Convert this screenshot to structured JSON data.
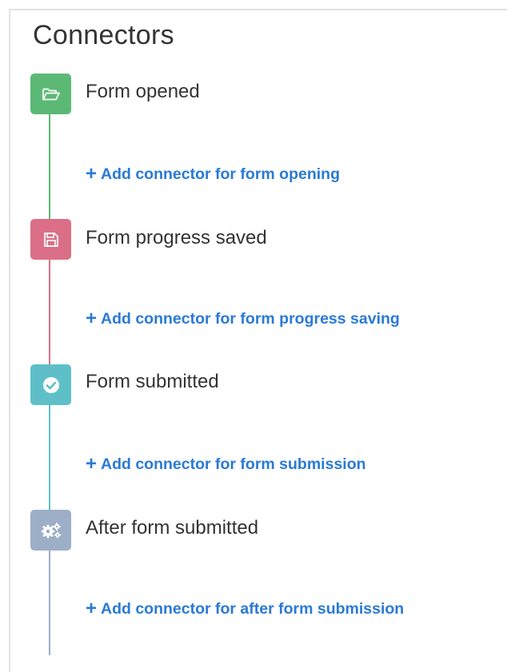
{
  "title": "Connectors",
  "colors": {
    "opened": "#5cb975",
    "saved": "#db6f87",
    "submitted": "#5fbfc8",
    "after": "#9daec7",
    "link": "#2a7ad6"
  },
  "events": [
    {
      "label": "Form opened",
      "icon": "folder-open-icon",
      "add_label": "Add connector for form opening"
    },
    {
      "label": "Form progress saved",
      "icon": "floppy-disk-icon",
      "add_label": "Add connector for form progress saving"
    },
    {
      "label": "Form submitted",
      "icon": "check-circle-icon",
      "add_label": "Add connector for form submission"
    },
    {
      "label": "After form submitted",
      "icon": "gears-icon",
      "add_label": "Add connector for after form submission"
    }
  ]
}
